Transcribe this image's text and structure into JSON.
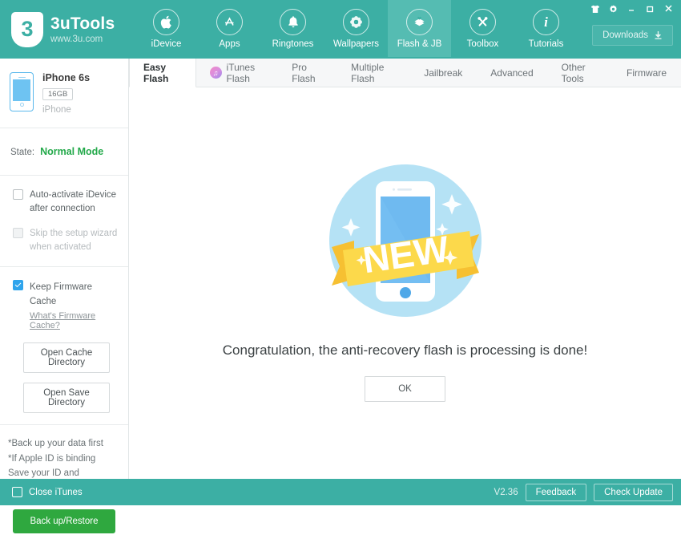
{
  "header": {
    "logo_title": "3uTools",
    "logo_sub": "www.3u.com",
    "logo_mark": "3",
    "nav": [
      {
        "label": "iDevice",
        "icon": "apple-icon",
        "active": false
      },
      {
        "label": "Apps",
        "icon": "appstore-icon",
        "active": false
      },
      {
        "label": "Ringtones",
        "icon": "bell-icon",
        "active": false
      },
      {
        "label": "Wallpapers",
        "icon": "flower-icon",
        "active": false
      },
      {
        "label": "Flash & JB",
        "icon": "flash-box-icon",
        "active": true
      },
      {
        "label": "Toolbox",
        "icon": "tools-icon",
        "active": false
      },
      {
        "label": "Tutorials",
        "icon": "info-icon",
        "active": false
      }
    ],
    "window_buttons": [
      {
        "name": "skin-icon",
        "glyph": "T"
      },
      {
        "name": "gear-icon",
        "glyph": "⚙"
      },
      {
        "name": "minimize-icon",
        "glyph": "–"
      },
      {
        "name": "maximize-icon",
        "glyph": "□"
      },
      {
        "name": "close-icon",
        "glyph": "✕"
      }
    ],
    "downloads_label": "Downloads",
    "downloads_icon": "download-arrow-icon"
  },
  "sidebar": {
    "device": {
      "name": "iPhone 6s",
      "capacity": "16GB",
      "type": "iPhone"
    },
    "state": {
      "label": "State:",
      "value": "Normal Mode",
      "color": "#23A94A"
    },
    "options": [
      {
        "label": "Auto-activate iDevice after connection",
        "checked": false,
        "disabled": false
      },
      {
        "label": "Skip the setup wizard when activated",
        "checked": false,
        "disabled": true
      }
    ],
    "cache": {
      "label": "Keep Firmware Cache",
      "checked": true,
      "link": "What's Firmware Cache?",
      "buttons": [
        "Open Cache Directory",
        "Open Save Directory"
      ]
    },
    "notes": [
      "*Back up your data first",
      "*If Apple ID is binding",
      "Save your ID and Password"
    ],
    "backup_label": "Back up/Restore",
    "backup_color": "#2FA83F"
  },
  "main": {
    "tabs": [
      {
        "label": "Easy Flash",
        "icon": null,
        "active": true
      },
      {
        "label": "iTunes Flash",
        "icon": "itunes-icon",
        "active": false
      },
      {
        "label": "Pro Flash",
        "icon": null,
        "active": false
      },
      {
        "label": "Multiple Flash",
        "icon": null,
        "active": false
      },
      {
        "label": "Jailbreak",
        "icon": null,
        "active": false
      },
      {
        "label": "Advanced",
        "icon": null,
        "active": false
      },
      {
        "label": "Other Tools",
        "icon": null,
        "active": false
      },
      {
        "label": "Firmware",
        "icon": null,
        "active": false
      }
    ],
    "message": "Congratulation, the anti-recovery flash is processing is done!",
    "ok_label": "OK",
    "illustration": {
      "name": "new-phone-badge-illustration",
      "ribbon_text": "NEW",
      "circle_color": "#B5E2F5",
      "ribbon_color": "#FCD94B",
      "screen_color": "#74BEF2"
    }
  },
  "footer": {
    "close_itunes_label": "Close iTunes",
    "close_itunes_checked": false,
    "version": "V2.36",
    "feedback_label": "Feedback",
    "check_update_label": "Check Update"
  },
  "theme": {
    "teal": "#3CAFA4",
    "teal_active": "#55BCB2",
    "blue": "#2FA4EC",
    "green": "#23A94A"
  }
}
